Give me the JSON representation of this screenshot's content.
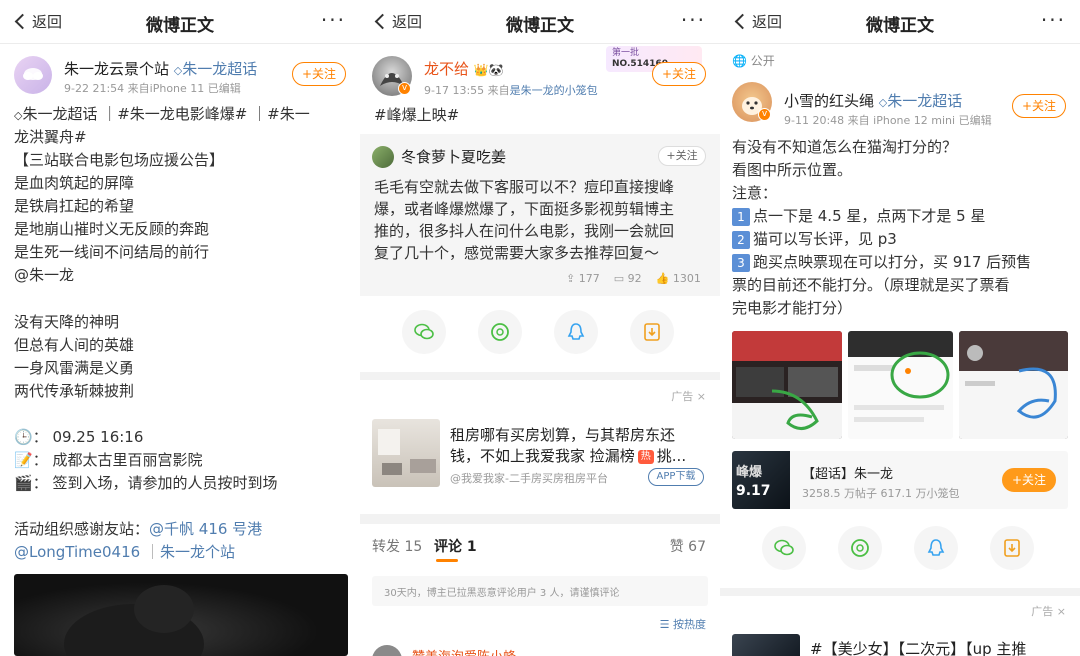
{
  "panel1": {
    "nav": {
      "back": "返回",
      "title": "微博正文",
      "more": "···"
    },
    "user": {
      "name": "朱一龙云景个站",
      "super_label": "朱一龙超话",
      "meta": "9-22 21:54  来自iPhone 11 已编辑",
      "follow": "+关注"
    },
    "tags_line1": "朱一龙超话 ｜#朱一龙电影峰爆# ｜#朱一",
    "tags_line2": "龙洪翼舟#",
    "lines": [
      "【三站联合电影包场应援公告】",
      "是血肉筑起的屏障",
      "是铁肩扛起的希望",
      "是地崩山摧时义无反顾的奔跑",
      "是生死一线间不问结局的前行"
    ],
    "mention": "@朱一龙",
    "poem": [
      "没有天降的神明",
      "但总有人间的英雄",
      "一身风雷满是义勇",
      "两代传承斩棘披荆"
    ],
    "details": [
      {
        "icon": "clock-icon",
        "glyph": "🕒",
        "text": "：  09.25 16:16"
      },
      {
        "icon": "memo-icon",
        "glyph": "📝",
        "text": "：  成都太古里百丽宫影院"
      },
      {
        "icon": "clapper-icon",
        "glyph": "🎬",
        "text": "：  签到入场，请参加的人员按时到场"
      }
    ],
    "thanks_label": "活动组织感谢友站：",
    "thanks_link1": "@千帆 416 号港",
    "thanks_link2": "@LongTime0416",
    "thanks_link3": "朱一龙个站"
  },
  "panel2": {
    "nav": {
      "back": "返回",
      "title": "微博正文",
      "more": "···"
    },
    "user": {
      "name": "龙不给",
      "meta_time": "9-17 13:55  来自",
      "meta_source": "是朱一龙的小笼包",
      "follow": "+关注",
      "badge_text": "第一批",
      "badge_no": "NO.514160"
    },
    "tag": "#峰爆上映#",
    "repost": {
      "name": "冬食萝卜夏吃姜",
      "follow": "+关注",
      "lines": [
        "毛毛有空就去做下客服可以不？痘印直接搜峰",
        "爆，或者峰爆燃爆了，下面挺多影视剪辑博主",
        "推的，很多抖人在问什么电影，我刚一会就回",
        "复了几十个，感觉需要大家多去推荐回复～"
      ],
      "stats": {
        "reposts": "177",
        "comments": "92",
        "likes": "1301"
      }
    },
    "ad": {
      "label": "广告",
      "close": "×",
      "title_line1": "租房哪有买房划算，与其帮房东还",
      "title_line2": "钱，不如上我爱我家 捡漏榜",
      "title_tail": "挑...",
      "hot_badge": "热",
      "source": "@我爱我家-二手房买房租房平台",
      "download": "APP下载"
    },
    "tabs": {
      "repost": "转发 15",
      "comment": "评论 1",
      "like": "赞 67"
    },
    "notice": "30天内，博主已拉黑恶意评论用户 3 人，请谨慎评论",
    "sort": "按热度",
    "next_name": "赞美海泡爱陈小蜂"
  },
  "panel3": {
    "nav": {
      "back": "返回",
      "title": "微博正文",
      "more": "···"
    },
    "public": "公开",
    "user": {
      "name": "小雪的红头绳",
      "super_label": "朱一龙超话",
      "meta": "9-11 20:48  来自 iPhone 12 mini  已编辑",
      "follow": "+关注"
    },
    "lines": [
      "有没有不知道怎么在猫淘打分的？",
      "看图中所示位置。",
      "注意："
    ],
    "notes": [
      {
        "num": "1",
        "text": "点一下是 4.5 星，点两下才是 5 星"
      },
      {
        "num": "2",
        "text": "猫可以写长评，见 p3"
      },
      {
        "num": "3",
        "text": "跑买点映票现在可以打分，买 917 后预售"
      }
    ],
    "note3_line2": "票的目前还不能打分。（原理就是买了票看",
    "note3_line3": "完电影才能打分）",
    "card": {
      "title": "【超话】朱一龙",
      "stats": "3258.5 万帖子 617.1 万小笼包",
      "follow": "+关注",
      "thumb_text": "峰爆",
      "thumb_date": "9.17"
    },
    "ad_label": "广告",
    "ad_close": "×",
    "next_text": "#【美少女】【二次元】【up 主推"
  },
  "colors": {
    "link": "#507daf",
    "orange": "#ff8200",
    "bg_gray": "#f7f7f7"
  }
}
